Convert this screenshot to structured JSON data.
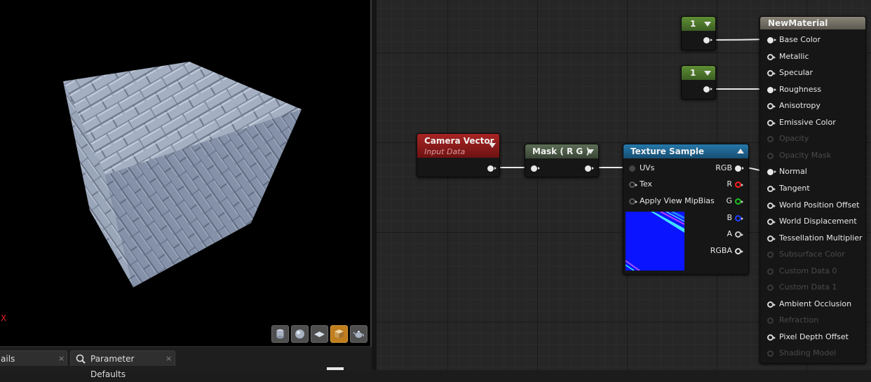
{
  "viewport": {
    "axis_label": "X",
    "buttons": [
      {
        "icon": "cylinder-icon",
        "active": false
      },
      {
        "icon": "sphere-icon",
        "active": false
      },
      {
        "icon": "plane-icon",
        "active": false
      },
      {
        "icon": "cube-icon",
        "active": true
      },
      {
        "icon": "teapot-icon",
        "active": false
      }
    ]
  },
  "bottom_tabs": [
    {
      "label": "ails",
      "close": "×"
    },
    {
      "label": "Parameter Defaults",
      "close": "×",
      "icon": "search-icon"
    }
  ],
  "nodes": {
    "constant_1": {
      "value": "1"
    },
    "constant_2": {
      "value": "1"
    },
    "camera_vector": {
      "title": "Camera Vector",
      "subtitle": "Input Data",
      "header_color": "#8a1a1a"
    },
    "mask": {
      "title": "Mask ( R G )",
      "header_color": "#4a5a44"
    },
    "texture_sample": {
      "title": "Texture Sample",
      "header_color": "#1d5a82",
      "inputs": [
        "UVs",
        "Tex",
        "Apply View MipBias"
      ],
      "outputs": [
        "RGB",
        "R",
        "G",
        "B",
        "A",
        "RGBA"
      ]
    },
    "material": {
      "title": "NewMaterial",
      "header_color": "#6e6a60",
      "inputs": [
        {
          "label": "Base Color",
          "state": "connected"
        },
        {
          "label": "Metallic",
          "state": "open"
        },
        {
          "label": "Specular",
          "state": "open"
        },
        {
          "label": "Roughness",
          "state": "connected"
        },
        {
          "label": "Anisotropy",
          "state": "open"
        },
        {
          "label": "Emissive Color",
          "state": "open"
        },
        {
          "label": "Opacity",
          "state": "disabled"
        },
        {
          "label": "Opacity Mask",
          "state": "disabled"
        },
        {
          "label": "Normal",
          "state": "connected"
        },
        {
          "label": "Tangent",
          "state": "open"
        },
        {
          "label": "World Position Offset",
          "state": "open"
        },
        {
          "label": "World Displacement",
          "state": "open"
        },
        {
          "label": "Tessellation Multiplier",
          "state": "open"
        },
        {
          "label": "Subsurface Color",
          "state": "disabled"
        },
        {
          "label": "Custom Data 0",
          "state": "disabled"
        },
        {
          "label": "Custom Data 1",
          "state": "disabled"
        },
        {
          "label": "Ambient Occlusion",
          "state": "open"
        },
        {
          "label": "Refraction",
          "state": "disabled"
        },
        {
          "label": "Pixel Depth Offset",
          "state": "open"
        },
        {
          "label": "Shading Model",
          "state": "disabled"
        }
      ]
    }
  },
  "colors": {
    "graph_bg": "#262626",
    "constant_header": "#4f7a2a",
    "pin_r": "#ff2020",
    "pin_g": "#20c020",
    "pin_b": "#2040ff",
    "pin_a": "#c8c8c8",
    "active_button": "#c07d1c"
  }
}
